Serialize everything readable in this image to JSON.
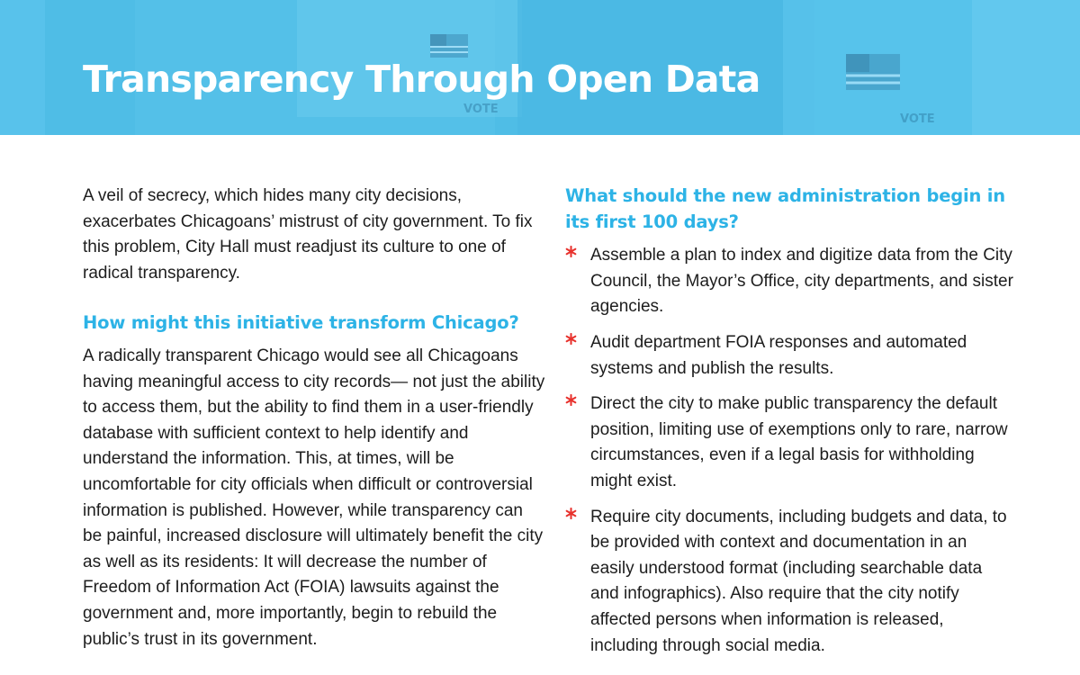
{
  "banner": {
    "title": "Transparency Through Open Data",
    "photo_signs": [
      "VOTE",
      "VOTE"
    ],
    "colors": {
      "overlay": "#4fbde6",
      "title": "#ffffff"
    }
  },
  "left_column": {
    "intro": "A veil of secrecy, which hides many city decisions, exacerbates Chicagoans’ mistrust of city government. To fix this problem, City Hall must readjust its culture to one of radical transparency.",
    "heading": "How might this initiative transform Chicago?",
    "body": "A radically transparent Chicago would see all Chicagoans having meaningful access to city records— not just the ability to access them, but the ability to find them in a user-friendly database with sufficient context to help identify and understand the information. This, at times, will be uncomfortable for city officials when difficult or controversial information is published. However, while transparency can be painful, increased disclosure will ultimately benefit the city as well as its residents: It will decrease the number of Freedom of Information Act (FOIA) lawsuits against the government and, more importantly, begin to rebuild the public’s trust in its government."
  },
  "right_column": {
    "heading": "What should the new administration begin in its first 100 days?",
    "bullets": [
      "Assemble a plan to index and digitize data from the City Council, the Mayor’s Office, city departments, and sister agencies.",
      "Audit department FOIA responses and automated systems and publish the results.",
      "Direct the city to make public transparency the default position, limiting use of exemptions only to rare, narrow circumstances, even if a legal basis for withholding might exist.",
      "Require city documents, including budgets and data, to be provided with context and documentation in an easily understood format (including searchable data and infographics). Also require that the city notify affected persons when information is released, including through social media."
    ]
  },
  "style": {
    "accent": "#2db3e6",
    "bullet_star": "#e8322d",
    "text": "#1d1d1d",
    "bullet_icon": "six-point-star-icon"
  }
}
